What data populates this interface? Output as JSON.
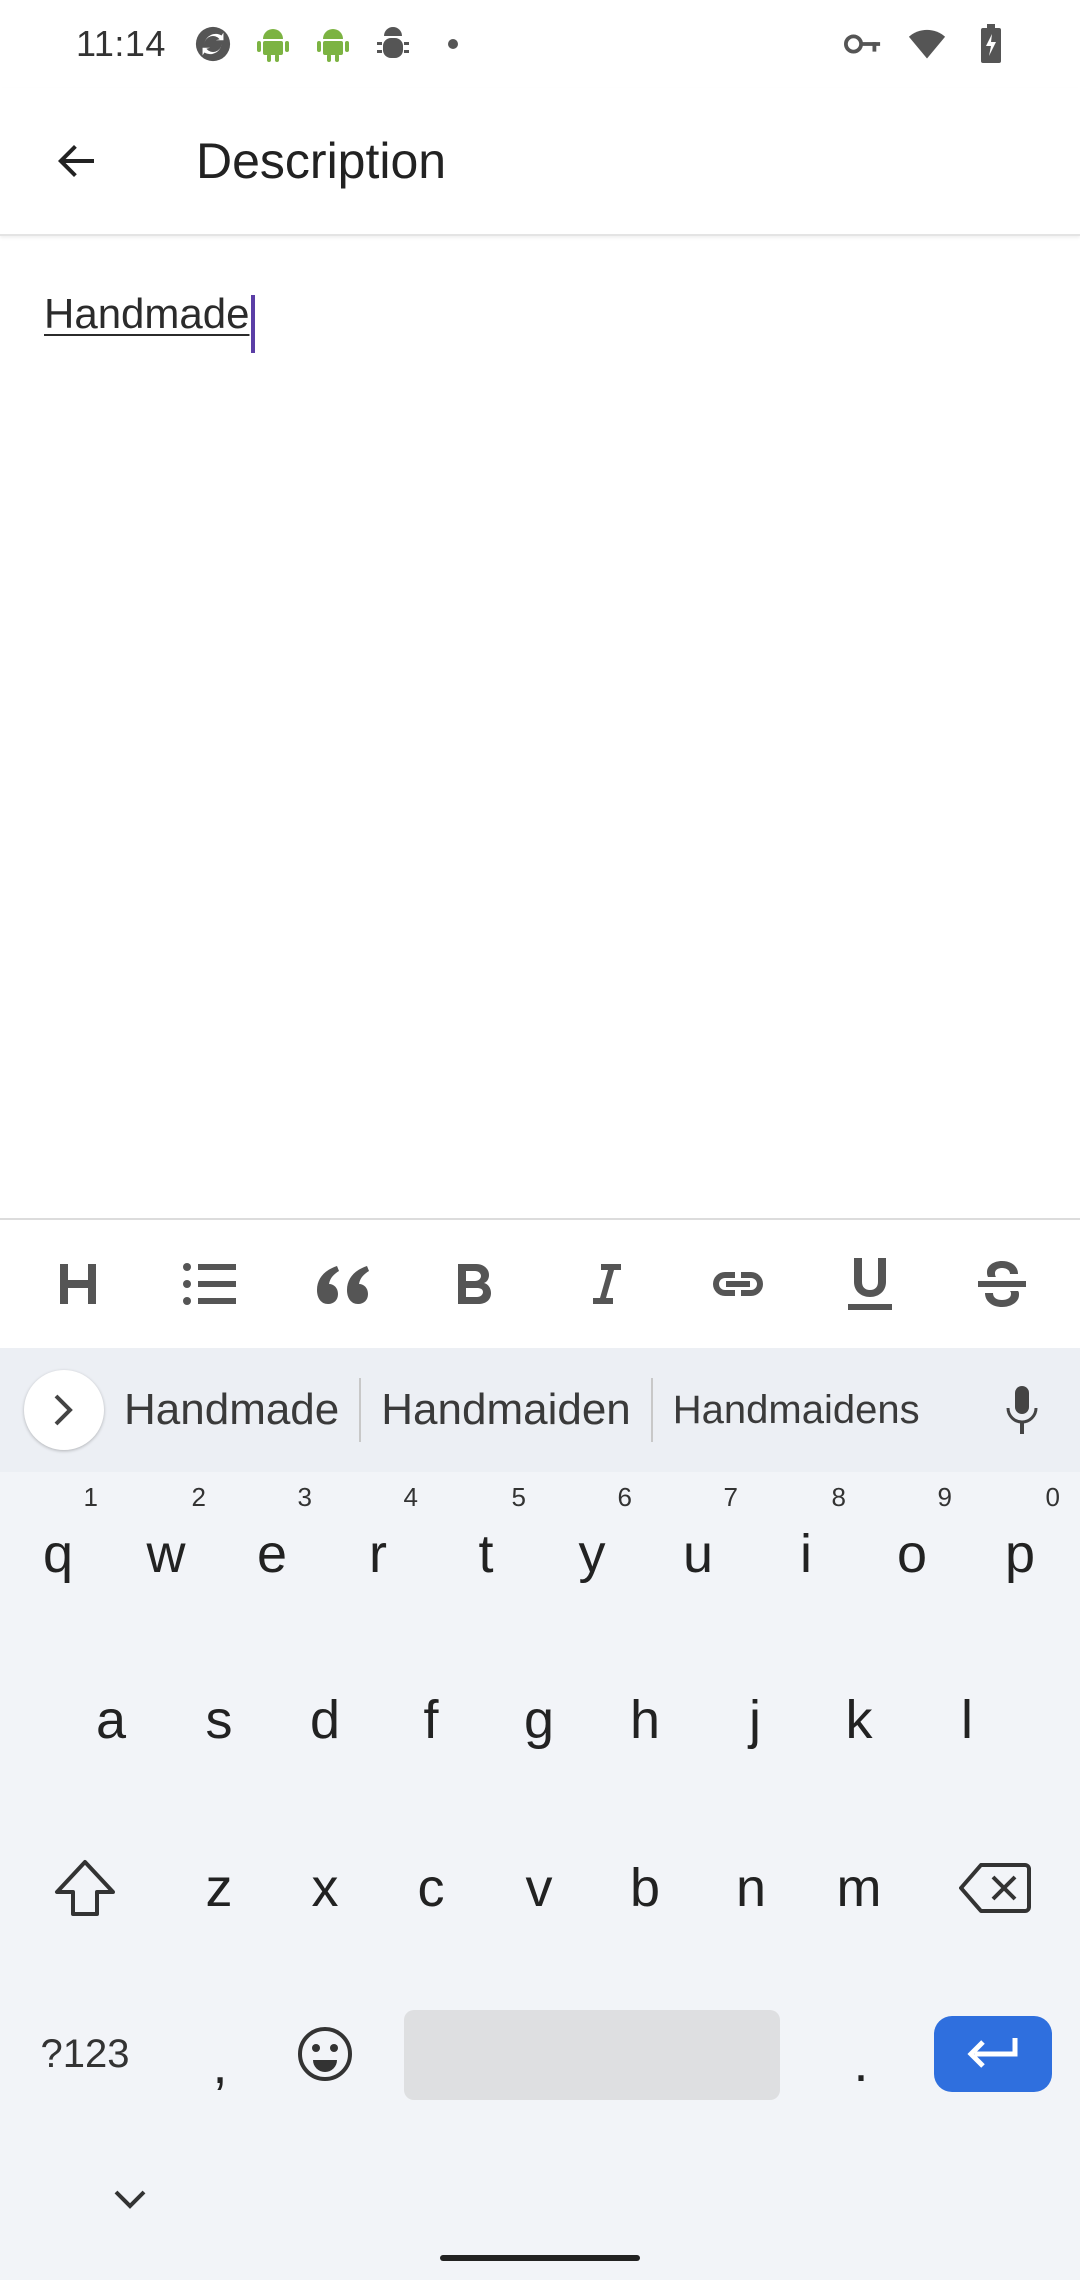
{
  "status_bar": {
    "time": "11:14",
    "left_icons": [
      "sync-icon",
      "android-icon",
      "android-icon",
      "android-debug-icon",
      "dot-icon"
    ],
    "right_icons": [
      "vpn-key-icon",
      "wifi-icon",
      "battery-charging-icon"
    ]
  },
  "app_bar": {
    "title": "Description"
  },
  "editor": {
    "text": "Handmade"
  },
  "format_toolbar": {
    "buttons": [
      "heading-icon",
      "bullet-list-icon",
      "quote-icon",
      "bold-icon",
      "italic-icon",
      "link-icon",
      "underline-icon",
      "strikethrough-icon"
    ]
  },
  "keyboard": {
    "suggestions": [
      "Handmade",
      "Handmaiden",
      "Handmaidens"
    ],
    "row1": [
      {
        "key": "q",
        "hint": "1"
      },
      {
        "key": "w",
        "hint": "2"
      },
      {
        "key": "e",
        "hint": "3"
      },
      {
        "key": "r",
        "hint": "4"
      },
      {
        "key": "t",
        "hint": "5"
      },
      {
        "key": "y",
        "hint": "6"
      },
      {
        "key": "u",
        "hint": "7"
      },
      {
        "key": "i",
        "hint": "8"
      },
      {
        "key": "o",
        "hint": "9"
      },
      {
        "key": "p",
        "hint": "0"
      }
    ],
    "row2": [
      "a",
      "s",
      "d",
      "f",
      "g",
      "h",
      "j",
      "k",
      "l"
    ],
    "row3": [
      "z",
      "x",
      "c",
      "v",
      "b",
      "n",
      "m"
    ],
    "symbols_label": "?123",
    "comma_label": ",",
    "period_label": "."
  },
  "colors": {
    "accent_caret": "#5b3ea6",
    "enter_key": "#2f6fde",
    "keyboard_bg": "#f2f4f8"
  }
}
